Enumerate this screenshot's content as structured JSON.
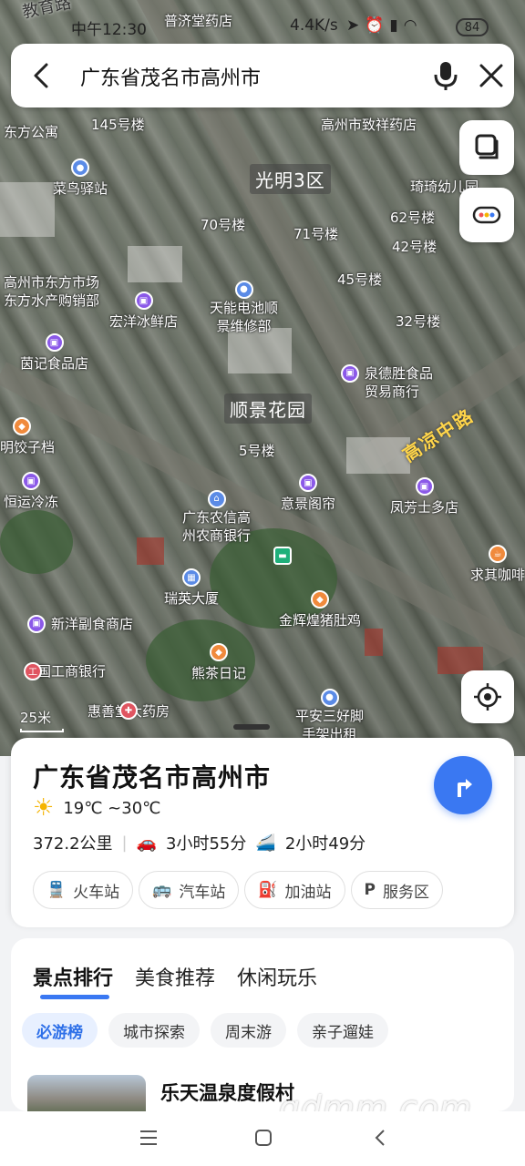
{
  "status_bar": {
    "time": "中午12:30",
    "network_speed": "4.4K/s",
    "battery": "84"
  },
  "search": {
    "query": "广东省茂名市高州市"
  },
  "map": {
    "area_labels": [
      "光明3区",
      "顺景花园"
    ],
    "road_label": "高凉中路",
    "scale": "25米",
    "pois": [
      {
        "label": "东方公寓"
      },
      {
        "label": "145号楼"
      },
      {
        "label": "菜鸟驿站"
      },
      {
        "label": "高州市致祥药店"
      },
      {
        "label": "琦琦幼儿园"
      },
      {
        "label": "70号楼"
      },
      {
        "label": "71号楼"
      },
      {
        "label": "62号楼"
      },
      {
        "label": "42号楼"
      },
      {
        "label": "高州市东方市场"
      },
      {
        "label": "东方水产购销部"
      },
      {
        "label": "45号楼"
      },
      {
        "label": "天能电池顺"
      },
      {
        "label": "景维修部"
      },
      {
        "label": "宏洋冰鲜店"
      },
      {
        "label": "32号楼"
      },
      {
        "label": "茵记食品店"
      },
      {
        "label": "泉德胜食品"
      },
      {
        "label": "贸易商行"
      },
      {
        "label": "明饺子档"
      },
      {
        "label": "5号楼"
      },
      {
        "label": "恒运冷冻"
      },
      {
        "label": "意景阁帘"
      },
      {
        "label": "凤芳士多店"
      },
      {
        "label": "广东农信高"
      },
      {
        "label": "州农商银行"
      },
      {
        "label": "瑞英大厦"
      },
      {
        "label": "求其咖啡"
      },
      {
        "label": "新洋副食商店"
      },
      {
        "label": "金辉煌猪肚鸡"
      },
      {
        "label": "中国工商银行"
      },
      {
        "label": "熊茶日记"
      },
      {
        "label": "惠善堂大药房"
      },
      {
        "label": "平安三好脚"
      },
      {
        "label": "手架出租"
      },
      {
        "label": "普济堂药店"
      },
      {
        "label": "教育路"
      }
    ]
  },
  "card": {
    "title": "广东省茂名市高州市",
    "weather": "19℃ ~30℃",
    "distance": "372.2公里",
    "drive_time": "3小时55分",
    "train_time": "2小时49分",
    "chips": [
      "火车站",
      "汽车站",
      "加油站",
      "服务区"
    ]
  },
  "explore": {
    "tabs": [
      "景点排行",
      "美食推荐",
      "休闲玩乐"
    ],
    "subtabs": [
      "必游榜",
      "城市探索",
      "周末游",
      "亲子遛娃"
    ],
    "first_place": "乐天温泉度假村"
  },
  "watermark": "gdmm.com",
  "colors": {
    "accent": "#3a78f2",
    "poi_purple": "#8b59e8",
    "road_label": "#ffd54a"
  }
}
